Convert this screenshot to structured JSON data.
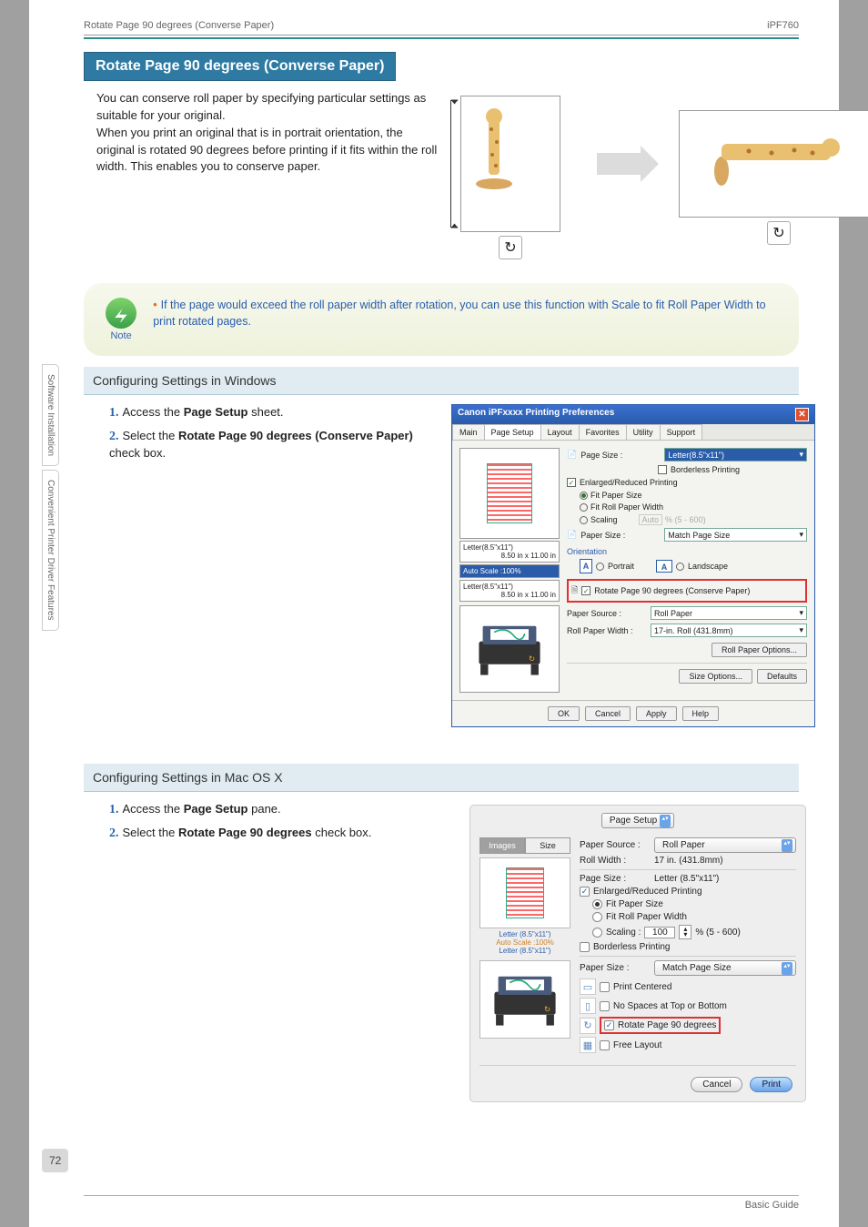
{
  "header": {
    "left": "Rotate Page 90 degrees (Converse Paper)",
    "right": "iPF760"
  },
  "title": "Rotate Page 90 degrees (Converse Paper)",
  "intro": "You can conserve roll paper by specifying particular settings as suitable for your original.\nWhen you print an original that is in portrait orientation, the original is rotated 90 degrees before printing if it fits within the roll width. This enables you to conserve paper.",
  "note": {
    "label": "Note",
    "text": "If the page would exceed the roll paper width after rotation, you can use this function with Scale to fit Roll Paper Width to print rotated pages."
  },
  "win": {
    "heading": "Configuring Settings in Windows",
    "steps": [
      {
        "pre": "Access the ",
        "bold": "Page Setup",
        "post": " sheet."
      },
      {
        "pre": "Select the ",
        "bold": "Rotate Page 90 degrees (Conserve Paper)",
        "post": " check box."
      }
    ],
    "dlg": {
      "title": "Canon iPFxxxx Printing Preferences",
      "tabs": [
        "Main",
        "Page Setup",
        "Layout",
        "Favorites",
        "Utility",
        "Support"
      ],
      "active_tab": "Page Setup",
      "left_size1": "Letter(8.5\"x11\")",
      "left_dim1": "8.50 in x 11.00 in",
      "left_scale": "Auto Scale :100%",
      "left_size2": "Letter(8.5\"x11\")",
      "left_dim2": "8.50 in x 11.00 in",
      "page_size_label": "Page Size :",
      "page_size_value": "Letter(8.5\"x11\")",
      "borderless": "Borderless Printing",
      "enlreduce": "Enlarged/Reduced Printing",
      "fit_paper": "Fit Paper Size",
      "fit_roll": "Fit Roll Paper Width",
      "scaling": "Scaling",
      "scaling_val": "Auto",
      "scaling_range": "% (5 - 600)",
      "paper_size_label": "Paper Size :",
      "paper_size_value": "Match Page Size",
      "orientation": "Orientation",
      "portrait": "Portrait",
      "landscape": "Landscape",
      "rotate": "Rotate Page 90 degrees (Conserve Paper)",
      "paper_source_label": "Paper Source :",
      "paper_source_value": "Roll Paper",
      "roll_width_label": "Roll Paper Width :",
      "roll_width_value": "17-in. Roll (431.8mm)",
      "roll_options": "Roll Paper Options...",
      "size_options": "Size Options...",
      "defaults": "Defaults",
      "ok": "OK",
      "cancel": "Cancel",
      "apply": "Apply",
      "help": "Help"
    }
  },
  "mac": {
    "heading": "Configuring Settings in Mac OS X",
    "steps": [
      {
        "pre": "Access the ",
        "bold": "Page Setup",
        "post": " pane."
      },
      {
        "pre": "Select the ",
        "bold": "Rotate Page 90 degrees",
        "post": " check box."
      }
    ],
    "dlg": {
      "pane": "Page Setup",
      "tabs": [
        "Images",
        "Size"
      ],
      "active_tab": "Images",
      "info1": "Letter (8.5\"x11\")",
      "info2": "Auto Scale :100%",
      "info3": "Letter (8.5\"x11\")",
      "paper_source_label": "Paper Source :",
      "paper_source_value": "Roll Paper",
      "roll_width_label": "Roll Width :",
      "roll_width_value": "17 in. (431.8mm)",
      "page_size_label": "Page Size :",
      "page_size_value": "Letter (8.5\"x11\")",
      "enlreduce": "Enlarged/Reduced Printing",
      "fit_paper": "Fit Paper Size",
      "fit_roll": "Fit Roll Paper Width",
      "scaling_label": "Scaling :",
      "scaling_val": "100",
      "scaling_range": "% (5 - 600)",
      "borderless": "Borderless Printing",
      "paper_size2_label": "Paper Size :",
      "paper_size2_value": "Match Page Size",
      "print_centered": "Print Centered",
      "no_spaces": "No Spaces at Top or Bottom",
      "rotate": "Rotate Page 90 degrees",
      "free_layout": "Free Layout",
      "cancel": "Cancel",
      "print": "Print"
    }
  },
  "side": {
    "tab1": "Software Installation",
    "tab2": "Convenient Printer Driver Features"
  },
  "page_number": "72",
  "footer": "Basic Guide"
}
